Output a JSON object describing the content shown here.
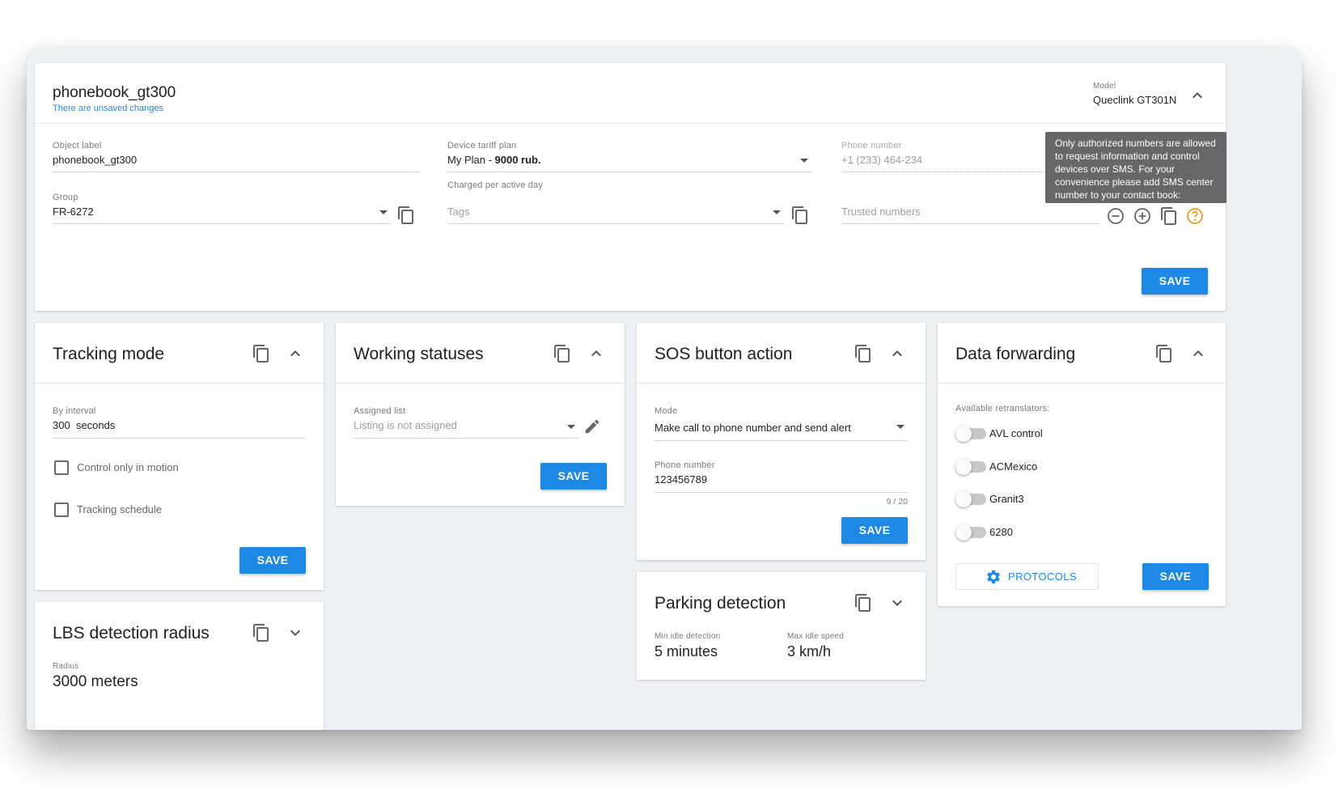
{
  "header": {
    "object_name": "phonebook_gt300",
    "unsaved_note": "There are unsaved changes",
    "model_label": "Model",
    "model_value": "Queclink GT301N"
  },
  "form": {
    "object_label": {
      "label": "Object label",
      "value": "phonebook_gt300"
    },
    "tariff": {
      "label": "Device tariff plan",
      "value_prefix": "My Plan - ",
      "value_bold": "9000 rub.",
      "hint": "Charged per active day"
    },
    "phone": {
      "label": "Phone number",
      "value": "+1 (233) 464-234"
    },
    "group": {
      "label": "Group",
      "value": "FR-6272"
    },
    "tags": {
      "placeholder": "Tags"
    },
    "trusted": {
      "placeholder": "Trusted numbers"
    },
    "save_label": "SAVE",
    "tooltip": "Only authorized numbers are allowed to request information and control devices over SMS. For your convenience please add SMS center number to your contact book:"
  },
  "tracking": {
    "title": "Tracking mode",
    "interval_label": "By interval",
    "interval_value": "300",
    "interval_unit": "seconds",
    "check1": "Control only in motion",
    "check2": "Tracking schedule",
    "save_label": "SAVE"
  },
  "lbs": {
    "title": "LBS detection radius",
    "radius_label": "Radius",
    "radius_value": "3000 meters"
  },
  "statuses": {
    "title": "Working statuses",
    "list_label": "Assigned list",
    "list_placeholder": "Listing is not assigned",
    "save_label": "SAVE"
  },
  "sos": {
    "title": "SOS button action",
    "mode_label": "Mode",
    "mode_value": "Make call to phone number and send alert",
    "phone_label": "Phone number",
    "phone_value": "123456789",
    "counter": "9 / 20",
    "save_label": "SAVE"
  },
  "parking": {
    "title": "Parking detection",
    "idle_label": "Min idle detection",
    "idle_value": "5 minutes",
    "speed_label": "Max idle speed",
    "speed_value": "3 km/h"
  },
  "forwarding": {
    "title": "Data forwarding",
    "available_label": "Available retranslators:",
    "retranslators": [
      "AVL control",
      "ACMexico",
      "Granit3",
      "6280"
    ],
    "protocols_label": "PROTOCOLS",
    "save_label": "SAVE"
  },
  "colors": {
    "accent": "#1e88e5",
    "help": "#f39c12",
    "tooltip_bg": "#616161"
  },
  "icons": [
    "copy-icon",
    "chevron-up-icon",
    "chevron-down-icon",
    "dropdown-caret-icon",
    "pencil-icon",
    "remove-circle-icon",
    "add-circle-icon",
    "help-circle-icon",
    "gear-icon"
  ]
}
